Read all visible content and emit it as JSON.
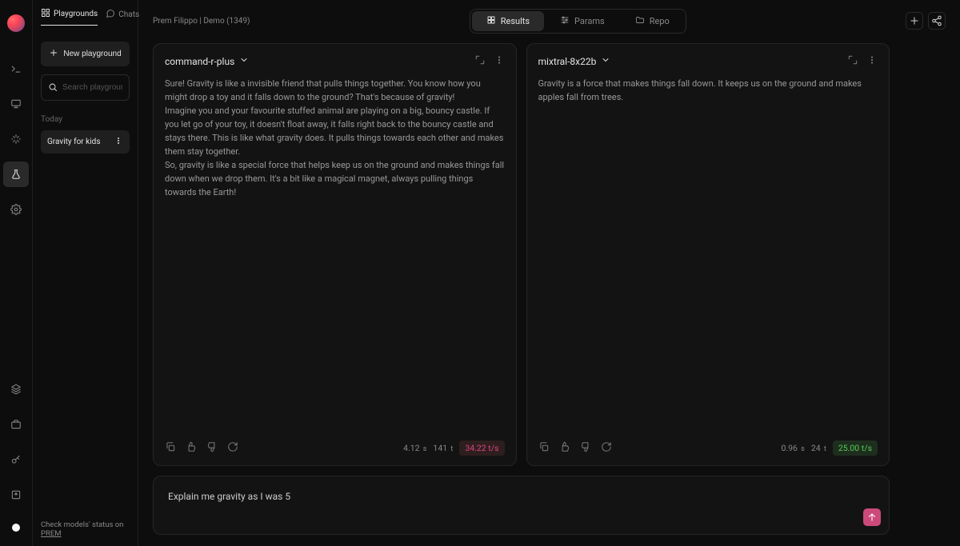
{
  "breadcrumb": "Prem Filippo  |  Demo (1349)",
  "sidebar": {
    "tabs": {
      "playgrounds": "Playgrounds",
      "chats": "Chats"
    },
    "new_button": "New playground",
    "search_placeholder": "Search playground",
    "section_label": "Today",
    "item_label": "Gravity for kids",
    "footer_prefix": "Check models' status on ",
    "footer_link": "PREM"
  },
  "segmented": {
    "results": "Results",
    "params": "Params",
    "repo": "Repo"
  },
  "cards": [
    {
      "title": "command-r-plus",
      "body": "Sure! Gravity is like a invisible friend that pulls things together. You know how you might drop a toy and it falls down to the ground? That's because of gravity!\nImagine you and your favourite stuffed animal are playing on a big, bouncy castle. If you let go of your toy, it doesn't float away, it falls right back to the bouncy castle and stays there. This is like what gravity does. It pulls things towards each other and makes them stay together.\nSo, gravity is like a special force that helps keep us on the ground and makes things fall down when we drop them. It's a bit like a magical magnet, always pulling things towards the Earth!",
      "time": "4.12",
      "tokens": "141",
      "rate": "34.22 t/s",
      "rate_color": "red"
    },
    {
      "title": "mixtral-8x22b",
      "body": "Gravity is a force that makes things fall down. It keeps us on the ground and makes apples fall from trees.",
      "time": "0.96",
      "tokens": "24",
      "rate": "25.00 t/s",
      "rate_color": "green"
    }
  ],
  "prompt": "Explain me gravity as I was 5"
}
